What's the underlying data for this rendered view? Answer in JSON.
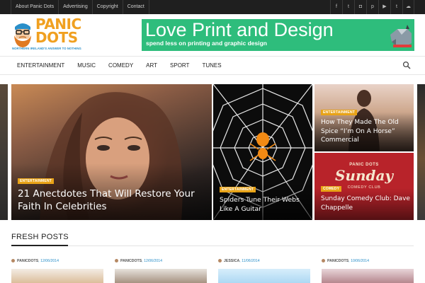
{
  "topbar": {
    "links": [
      "About Panic Dots",
      "Advertising",
      "Copyright",
      "Contact"
    ],
    "social_icons": [
      "facebook-icon",
      "twitter-icon",
      "instagram-icon",
      "pinterest-icon",
      "youtube-icon",
      "tumblr-icon",
      "soundcloud-icon"
    ],
    "social_glyphs": [
      "f",
      "t",
      "◘",
      "p",
      "▶",
      "t",
      "☁"
    ]
  },
  "logo": {
    "line1": "PANIC",
    "line2": "DOTS",
    "tagline": "NORTHERN IRELAND'S ANSWER TO NOTHING",
    "color": "#f0a020"
  },
  "banner": {
    "title": "Love Print and Design",
    "subtitle": "spend less on printing and graphic design",
    "color": "#2ebd7c"
  },
  "nav": {
    "items": [
      "ENTERTAINMENT",
      "MUSIC",
      "COMEDY",
      "ART",
      "SPORT",
      "TUNES"
    ]
  },
  "featured": [
    {
      "category": "ENTERTAINMENT",
      "title": "21 Anectdotes That Will Restore Your Faith In Celebrities"
    },
    {
      "category": "ENTERTAINMENT",
      "title": "Spiders Tune Their Webs Like A Guitar"
    },
    {
      "category": "ENTERTAINMENT",
      "title": "How They Made The Old Spice “I’m On A Horse” Commercial"
    },
    {
      "category": "COMEDY",
      "title": "Sunday Comedy Club: Dave Chappelle",
      "image_text": {
        "line1": "PANIC DOTS",
        "line2": "Sunday",
        "line3": "COMEDY CLUB"
      }
    }
  ],
  "accent_color": "#e8a317",
  "fresh_posts": {
    "heading": "FRESH POSTS",
    "items": [
      {
        "author": "PANICDOTS",
        "date": "12/06/2014"
      },
      {
        "author": "PANICDOTS",
        "date": "12/06/2014"
      },
      {
        "author": "JESSICA",
        "date": "11/06/2014"
      },
      {
        "author": "PANICDOTS",
        "date": "10/06/2014"
      }
    ]
  }
}
